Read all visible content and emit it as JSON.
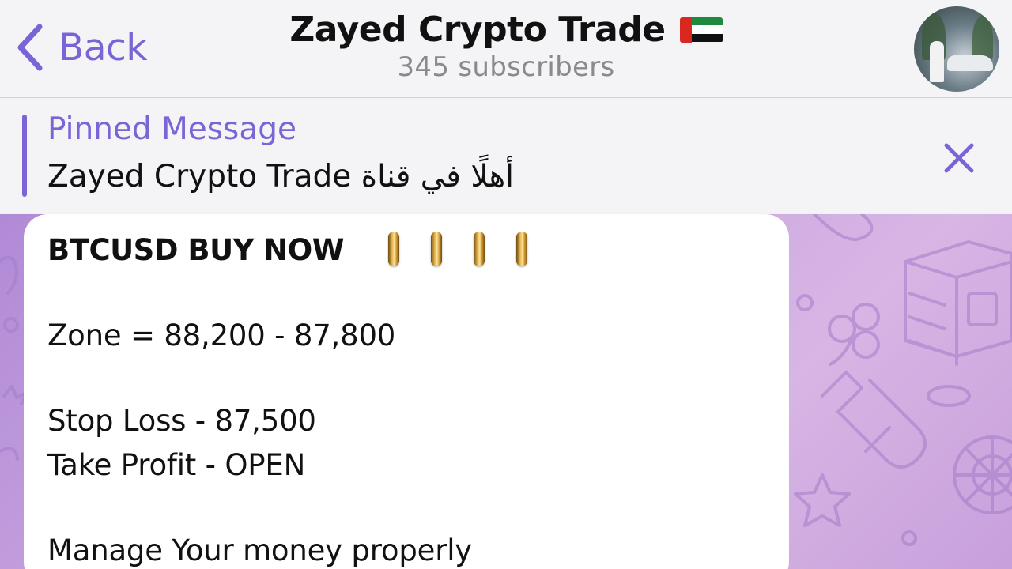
{
  "header": {
    "back_label": "Back",
    "title": "Zayed Crypto Trade",
    "subtitle": "345 subscribers",
    "flag_colors": {
      "red": "#d8281f",
      "green": "#1e8a3e",
      "white": "#ffffff",
      "black": "#111111"
    }
  },
  "pinned": {
    "title": "Pinned Message",
    "text": "Zayed Crypto Trade أهلًا في قناة"
  },
  "message": {
    "lines": [
      "BTCUSD BUY NOW",
      "Zone = 88,200 - 87,800",
      "Stop Loss - 87,500",
      "Take Profit - OPEN",
      "Manage Your money properly"
    ],
    "emoji": "coin x4"
  },
  "colors": {
    "accent": "#7b64d6",
    "header_bg": "#f4f4f6",
    "bubble_bg": "#ffffff",
    "chat_bg": "#c9a6e0"
  }
}
